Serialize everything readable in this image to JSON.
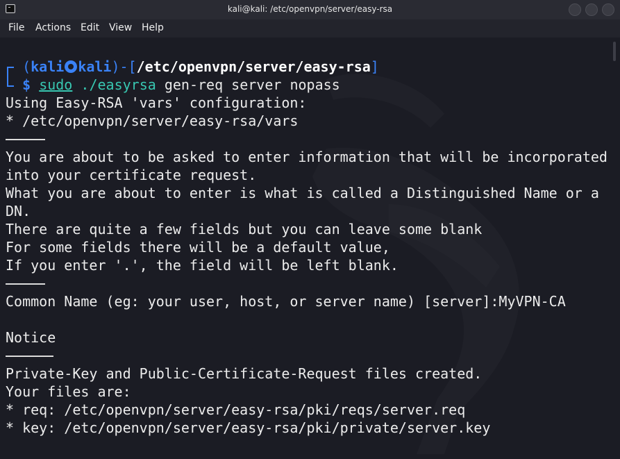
{
  "window": {
    "title": "kali@kali: /etc/openvpn/server/easy-rsa",
    "icon": "terminal-icon"
  },
  "menu": {
    "items": [
      "File",
      "Actions",
      "Edit",
      "View",
      "Help"
    ]
  },
  "prompt": {
    "open_paren": "(",
    "user": "kali",
    "host": "kali",
    "close_paren": ")",
    "dash": "-",
    "open_bracket": "[",
    "cwd": "/etc/openvpn/server/easy-rsa",
    "close_bracket": "]",
    "dollar": "$",
    "sudo": "sudo",
    "command": "./easyrsa",
    "args": "gen-req server nopass"
  },
  "output": {
    "l1": "Using Easy-RSA 'vars' configuration:",
    "l2": "* /etc/openvpn/server/easy-rsa/vars",
    "l3": "You are about to be asked to enter information that will be incorporated",
    "l4": "into your certificate request.",
    "l5": "What you are about to enter is what is called a Distinguished Name or a",
    "l6": "DN.",
    "l7": "There are quite a few fields but you can leave some blank",
    "l8": "For some fields there will be a default value,",
    "l9": "If you enter '.', the field will be left blank.",
    "l10": "Common Name (eg: your user, host, or server name) [server]:MyVPN-CA",
    "l11": "Notice",
    "l12": "Private-Key and Public-Certificate-Request files created.",
    "l13": "Your files are:",
    "l14": "* req: /etc/openvpn/server/easy-rsa/pki/reqs/server.req",
    "l15": "* key: /etc/openvpn/server/easy-rsa/pki/private/server.key"
  },
  "colors": {
    "prompt_blue": "#3a82f7",
    "command_teal": "#38c7b1",
    "background": "#1b1c24"
  }
}
